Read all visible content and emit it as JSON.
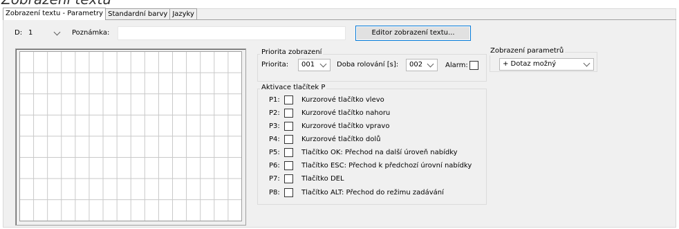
{
  "page_heading": "Zobrazení textu",
  "tabs": [
    {
      "label": "Zobrazení textu - Parametry"
    },
    {
      "label": "Standardní barvy"
    },
    {
      "label": "Jazyky"
    }
  ],
  "header": {
    "d_label": "D:",
    "d_value": "1",
    "note_label": "Poznámka:",
    "note_value": "",
    "editor_button": "Editor zobrazení textu..."
  },
  "grid": {
    "columns": 16,
    "rows": 8
  },
  "priority_group": {
    "title": "Priorita zobrazení",
    "priority_label": "Priorita:",
    "priority_value": "001",
    "scroll_label": "Doba rolování [s]:",
    "scroll_value": "002",
    "alarm_label": "Alarm:",
    "alarm_checked": false
  },
  "params_group": {
    "title": "Zobrazení parametrů",
    "value": "+ Dotaz možný"
  },
  "keys_group": {
    "title": "Aktivace tlačítek P",
    "items": [
      {
        "key": "P1:",
        "label": "Kurzorové tlačítko vlevo",
        "checked": false
      },
      {
        "key": "P2:",
        "label": "Kurzorové tlačítko nahoru",
        "checked": false
      },
      {
        "key": "P3:",
        "label": "Kurzorové tlačítko vpravo",
        "checked": false
      },
      {
        "key": "P4:",
        "label": "Kurzorové tlačítko dolů",
        "checked": false
      },
      {
        "key": "P5:",
        "label": "Tlačítko OK: Přechod na další úroveň nabídky",
        "checked": false
      },
      {
        "key": "P6:",
        "label": "Tlačítko ESC: Přechod k předchozí úrovní nabídky",
        "checked": false
      },
      {
        "key": "P7:",
        "label": "Tlačítko DEL",
        "checked": false
      },
      {
        "key": "P8:",
        "label": "Tlačítko ALT: Přechod do režimu zadávání",
        "checked": false
      }
    ]
  }
}
